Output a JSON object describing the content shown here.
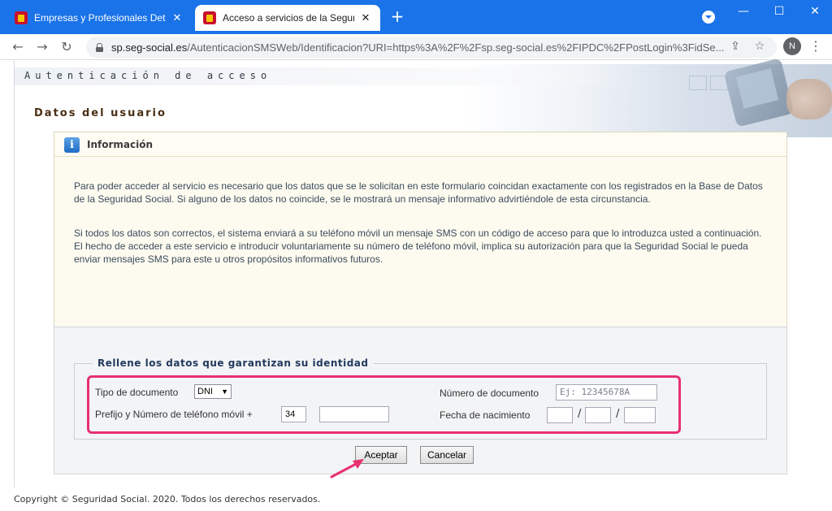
{
  "browser": {
    "tabs": [
      {
        "title": "Empresas y Profesionales Detalle",
        "active": false
      },
      {
        "title": "Acceso a servicios de la Seguridad",
        "active": true
      }
    ],
    "new_tab_symbol": "+",
    "window_controls": {
      "minimize": "—",
      "maximize": "☐",
      "close": "✕"
    },
    "url_host": "sp.seg-social.es",
    "url_rest": "/AutenticacionSMSWeb/Identificacion?URI=https%3A%2F%2Fsp.seg-social.es%2FIPDC%2FPostLogin%3FidSe...",
    "profile_initial": "N",
    "icons": [
      "back-icon",
      "forward-icon",
      "reload-icon",
      "lock-icon",
      "share-icon",
      "star-icon",
      "menu-icon"
    ],
    "accent_color": "#1a73e8"
  },
  "page": {
    "banner_title": "Autenticación de acceso",
    "section_title": "Datos del usuario",
    "info": {
      "title": "Información",
      "icon_glyph": "i",
      "paragraph1": "Para poder acceder al servicio es necesario que los datos que se le solicitan en este formulario coincidan exactamente con los registrados en la Base de Datos de la Seguridad Social. Si alguno de los datos no coincide, se le mostrará un mensaje informativo advirtiéndole de esta circunstancia.",
      "paragraph2": "Si todos los datos son correctos, el sistema enviará a su teléfono móvil un mensaje SMS con un código de acceso para que lo introduzca usted a continuación. El hecho de acceder a este servicio e introducir voluntariamente su número de teléfono móvil, implica su autorización para que la Seguridad Social le pueda enviar mensajes SMS para este u otros propósitos informativos futuros."
    },
    "form": {
      "legend": "Rellene los datos que garantizan su identidad",
      "tipo_documento_label": "Tipo de documento",
      "tipo_documento_value": "DNI",
      "numero_documento_label": "Número de documento",
      "numero_documento_placeholder": "Ej: 12345678A",
      "telefono_label": "Prefijo y Número de teléfono móvil +",
      "prefijo_value": "34",
      "telefono_value": "",
      "fecha_label": "Fecha de nacimiento",
      "date_separator": "/",
      "accept_button": "Aceptar",
      "cancel_button": "Cancelar",
      "highlight_color": "#e8306f"
    },
    "footer": "Copyright © Seguridad Social. 2020. Todos los derechos reservados."
  }
}
